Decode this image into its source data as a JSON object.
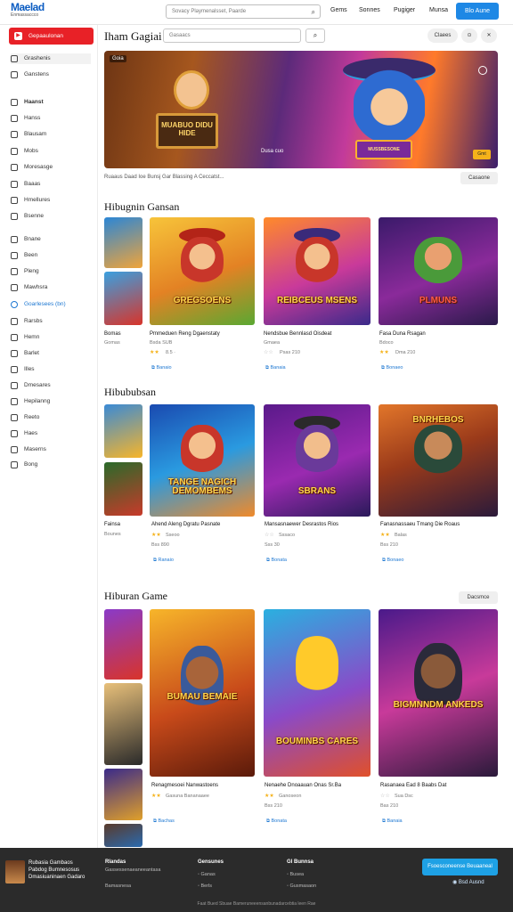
{
  "header": {
    "logo_title": "Maelad",
    "logo_sub": "Enmassaccco",
    "search_placeholder": "Sovacy Playmenalsset, Paarde",
    "nav": [
      "Gems",
      "Sonnes",
      "Pugiger",
      "Munsa"
    ],
    "signin_label": "Blo Aune"
  },
  "sidebar": {
    "primary_label": "Gepaaulonan",
    "items": [
      "Grashenis",
      "Ganstens",
      "Haanst",
      "Hanss",
      "Blausam",
      "Mobs",
      "Moresasge",
      "Baaas",
      "Hmellures",
      "Bsenne",
      "Bnane",
      "Been",
      "Pleng",
      "Mawhsra",
      "Goarlesees (bn)",
      "Rarsbs",
      "Hemn",
      "Barlet",
      "Illes",
      "Dmesares",
      "Hepilanng",
      "Reeto",
      "Haes",
      "Maserns",
      "Bong"
    ],
    "active_index": 3,
    "blue_label": "Goarlesees (bn)"
  },
  "main": {
    "title": "Iham Gagiai",
    "search_placeholder": "Gasaacs",
    "filter_label": "Claees"
  },
  "hero": {
    "tag": "Goia",
    "sign_text": "MUABUO DIDU HIDE",
    "sign2_text": "MUSSBESONE",
    "caption_overlay": "Dusa  cuo",
    "badge": "Gmt",
    "caption": "Ruaaus Daad Ioe Bunsj Gar Blassing A Ceccatst...",
    "button": "Casaone"
  },
  "sections": [
    {
      "title": "Hibugnin Gansan",
      "thumb_label": "Bomas",
      "thumb_meta": "Gomas",
      "cards": [
        {
          "art": "GREGSOENS",
          "title": "Pmmeduen Reng Dgaenstaty",
          "meta": "Bsda SUB",
          "stars": "★★",
          "extra": "8.5 ·",
          "link": "Banaio"
        },
        {
          "art": "REIBCEUS MSENS",
          "title": "Nendsbue Bennlasd Oisdeat",
          "meta": "Gmaea",
          "stars": "☆☆",
          "extra": "Psas 210",
          "link": "Banaia"
        },
        {
          "art": "PLMUNS",
          "title": "Fasa Duna Rsagan",
          "meta": "Bdoco",
          "stars": "★★",
          "extra": "Dma 210",
          "link": "Bonaeo"
        }
      ]
    },
    {
      "title": "Hibububsan",
      "thumb_label": "Fainsa",
      "thumb_meta": "Bounes",
      "cards": [
        {
          "art": "TANGE NAGICH DEMOMBEMS",
          "title": "Ahend Aleng Dgratu Pasnate",
          "meta": "Sseoo",
          "stars": "★★",
          "extra": "Bss 890",
          "link": "Ranaio"
        },
        {
          "art": "SBRANS",
          "title": "Mansasnaewer Desrastos Rios",
          "meta": "Sssaco",
          "stars": "☆☆",
          "extra": "Sss 30",
          "link": "Bonata"
        },
        {
          "art": "BNRHEBOS",
          "title": "Fanasnassaeu Tmang Die Roaus",
          "meta": "Balas",
          "stars": "★★",
          "extra": "Bss 210",
          "link": "Bonaeo"
        }
      ]
    },
    {
      "title": "Hiburan Game",
      "button": "Dacsmce",
      "cards": [
        {
          "art": "BUMAU BEMAIE",
          "title": "Renagmesoei Nanwastoens",
          "meta": "Gasuna Bananaaee",
          "stars": "★★",
          "extra": "",
          "link": "Bachas"
        },
        {
          "art": "BOUMINBS CARES",
          "title": "Nenaehe Dnoaauan Onas Sr.Ba",
          "meta": "Ganoseon",
          "stars": "★★",
          "extra": "Bss 210",
          "link": "Bonata"
        },
        {
          "art": "BIGMNNDM ANKEDS",
          "title": "Rasanaea Ead 8 Baabs Dat",
          "meta": "Sua Dsc",
          "stars": "☆☆",
          "extra": "Bas 210",
          "link": "Banaia"
        }
      ]
    }
  ],
  "footer": {
    "brand_lines": [
      "Rubasia Gambaos",
      "Pabdog Bumnesosus",
      "Dmasiuaninaen Gadaro"
    ],
    "cols": [
      {
        "heading": "Rlandas",
        "items": [
          "Gassessenaeaneeantasa",
          "",
          "Bamasnesa"
        ]
      },
      {
        "heading": "Gensunes",
        "items": [
          "Ganas",
          "Berls",
          ""
        ]
      },
      {
        "heading": "Gl Bunnsa",
        "items": [
          "Busea",
          "Gusmasaon",
          ""
        ]
      }
    ],
    "cta_label": "Fsoesconeense Beuaaneal",
    "link_label": "Bsd Ausnd",
    "copyright": "Faat Bued Sbuae Bameruneeensanbunadarcebtia leen Rae"
  },
  "colors": {
    "brand_blue": "#1e88e5",
    "brand_red": "#e82127",
    "link_blue": "#1e78d2",
    "footer_bg": "#2b2b2b"
  },
  "icons": [
    "search-icon",
    "grid-icon",
    "close-icon",
    "info-icon",
    "star-icon",
    "play-icon"
  ]
}
